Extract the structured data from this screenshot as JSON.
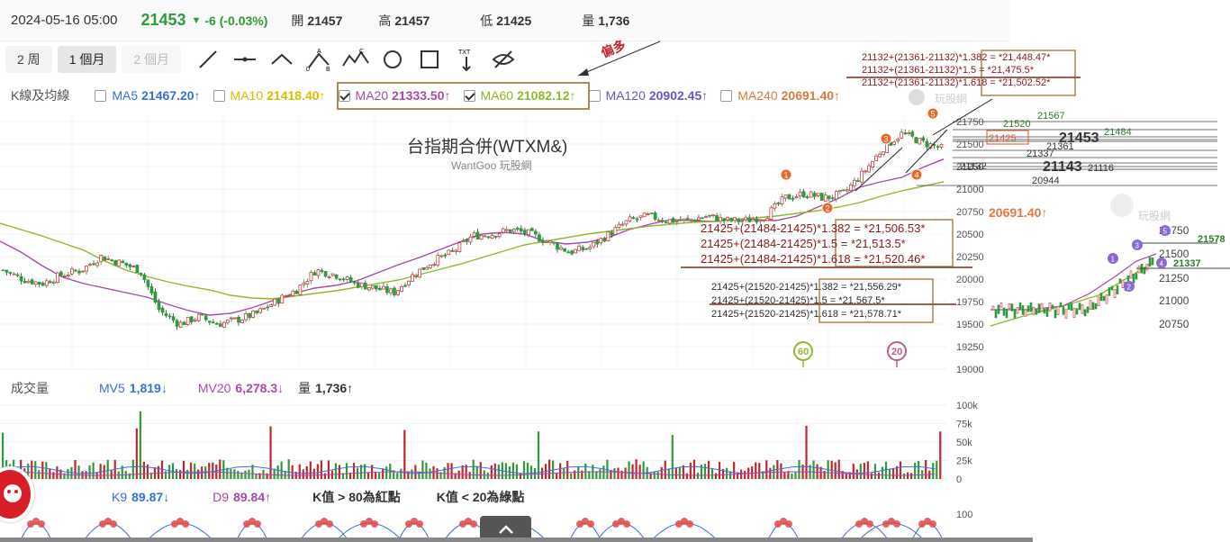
{
  "quote": {
    "date": "2024-05-16 05:00",
    "price": "21453",
    "change": "-6 (-0.03%)",
    "open_label": "開",
    "open": "21457",
    "high_label": "高",
    "high": "21457",
    "low_label": "低",
    "low": "21425",
    "vol_label": "量",
    "vol": "1,736"
  },
  "toolbar": {
    "periods": [
      "2 周",
      "1 個月",
      "2 個月"
    ],
    "active": 1
  },
  "colors": {
    "up": "#2e9b3a",
    "down": "#2e9b3a",
    "ma5": "#3a6fd8",
    "ma10": "#e0b800",
    "ma20": "#a64aa8",
    "ma60": "#8fb82a",
    "ma120": "#6a55c8",
    "ma240": "#e07a3c",
    "red": "#c0262e",
    "box": "#b08a5a"
  },
  "legend": {
    "label": "K線及均線",
    "items": [
      {
        "key": "ma5",
        "name": "MA5",
        "value": "21467.20",
        "arrow": "↑",
        "checked": false
      },
      {
        "key": "ma10",
        "name": "MA10",
        "value": "21418.40",
        "arrow": "↑",
        "checked": false
      },
      {
        "key": "ma20",
        "name": "MA20",
        "value": "21333.50",
        "arrow": "↑",
        "checked": true
      },
      {
        "key": "ma60",
        "name": "MA60",
        "value": "21082.12",
        "arrow": "↑",
        "checked": true
      },
      {
        "key": "ma120",
        "name": "MA120",
        "value": "20902.45",
        "arrow": "↑",
        "checked": false
      },
      {
        "key": "ma240",
        "name": "MA240",
        "value": "20691.40",
        "arrow": "↑",
        "checked": false
      }
    ]
  },
  "chart_data": {
    "type": "line",
    "title": "台指期合併(WTXM&)",
    "subtitle": "WantGoo 玩股網",
    "y_ticks": [
      19000,
      19250,
      19500,
      19750,
      20000,
      20250,
      20500,
      20750,
      21000,
      21250,
      21500,
      21750
    ],
    "ylim": [
      19000,
      21850
    ],
    "series": [
      {
        "name": "MA20",
        "values": [
          20420,
          20300,
          20150,
          20020,
          19950,
          19900,
          19850,
          19800,
          19720,
          19650,
          19600,
          19620,
          19680,
          19760,
          19840,
          19900,
          19930,
          19980,
          20070,
          20160,
          20240,
          20330,
          20420,
          20500,
          20520,
          20500,
          20420,
          20390,
          20410,
          20460,
          20550,
          20610,
          20660,
          20650,
          20640,
          20660,
          20660,
          20650,
          20700,
          20800,
          20900,
          21020,
          21080,
          21130,
          21240,
          21333
        ]
      },
      {
        "name": "MA60",
        "values": [
          20620,
          20550,
          20480,
          20400,
          20320,
          20200,
          20100,
          20030,
          19970,
          19920,
          19880,
          19820,
          19790,
          19780,
          19810,
          19840,
          19870,
          19910,
          19950,
          19990,
          20050,
          20110,
          20170,
          20240,
          20310,
          20380,
          20420,
          20460,
          20500,
          20530,
          20560,
          20590,
          20610,
          20630,
          20640,
          20660,
          20680,
          20700,
          20730,
          20760,
          20800,
          20850,
          20920,
          20980,
          21030,
          21082
        ]
      }
    ],
    "price_series": [
      20100,
      20000,
      19950,
      20050,
      20100,
      20250,
      20180,
      20100,
      19650,
      19500,
      19580,
      19500,
      19550,
      19620,
      19760,
      19880,
      20100,
      20050,
      19950,
      19900,
      19850,
      20050,
      20200,
      20300,
      20480,
      20500,
      20550,
      20500,
      20400,
      20300,
      20350,
      20500,
      20650,
      20700,
      20650,
      20650,
      20700,
      20650,
      20650,
      20700,
      20900,
      20950,
      20900,
      20950,
      21180,
      21450,
      21620,
      21520,
      21453
    ],
    "price_y": [
      19000,
      19250,
      19500,
      19750,
      20000,
      20250,
      20500,
      20750,
      21000,
      21250,
      21500,
      21750
    ],
    "h_lines": [
      {
        "value": "21567",
        "y": 21567
      },
      {
        "value": "21520",
        "y": 21520
      },
      {
        "value": "21484",
        "y": 21484
      },
      {
        "value": "21453",
        "y": 21453
      },
      {
        "value": "21425",
        "y": 21425
      },
      {
        "value": "21361",
        "y": 21361
      },
      {
        "value": "21337",
        "y": 21337
      },
      {
        "value": "21143",
        "y": 21143
      },
      {
        "value": "21132",
        "y": 21132
      },
      {
        "value": "21116",
        "y": 21116
      },
      {
        "value": "20944",
        "y": 20944
      }
    ],
    "ma240_marker": "20691.40↑",
    "annotation_offset_label": "偏多",
    "fib_top": [
      "21132+(21361-21132)*1.382 = *21,448.47*",
      "21132+(21361-21132)*1.5 = *21,475.5*",
      "21132+(21361-21132)*1.618 = *21,502.52*"
    ],
    "fib_mid": [
      "21425+(21484-21425)*1.382 = *21,506.53*",
      "21425+(21484-21425)*1.5 = *21,513.5*",
      "21425+(21484-21425)*1.618 = *21,520.46*"
    ],
    "fib_low": [
      "21425+(21520-21425)*1.382 = *21,556.29*",
      "21425+(21520-21425)*1.5 = *21,567.5*",
      "21425+(21520-21425)*1.618 = *21,578.71*"
    ],
    "wave_labels": [
      "1",
      "2",
      "3",
      "4",
      "5"
    ],
    "ma_badges": [
      "60",
      "20"
    ],
    "inset": {
      "y_ticks": [
        "20750",
        "21000",
        "21250",
        "21500",
        "21750"
      ],
      "levels": [
        "21578",
        "21337"
      ]
    }
  },
  "volume": {
    "label": "成交量",
    "mv5_name": "MV5",
    "mv5": "1,819",
    "mv5_arrow": "↓",
    "mv20_name": "MV20",
    "mv20": "6,278.3",
    "mv20_arrow": "↓",
    "vol_name": "量",
    "vol": "1,736",
    "vol_arrow": "↑",
    "y_ticks": [
      "100k",
      "75k",
      "50k",
      "25k",
      "0"
    ]
  },
  "kd": {
    "k_name": "K9",
    "k": "89.87",
    "k_arrow": "↓",
    "d_name": "D9",
    "d": "89.84",
    "d_arrow": "↑",
    "note1": "K值 > 80為紅點",
    "note2": "K值 < 20為綠點",
    "y_tick": "100"
  }
}
